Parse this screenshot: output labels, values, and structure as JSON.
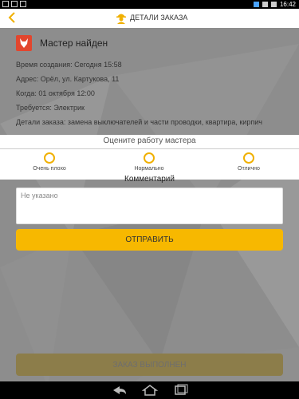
{
  "status_bar": {
    "time": "16:42"
  },
  "header": {
    "title": "ДЕТАЛИ ЗАКАЗА"
  },
  "order": {
    "status_title": "Мастер найден",
    "created": "Время создания: Сегодня 15:58",
    "address": "Адрес: Орёл, ул. Картукова, 11",
    "when": "Когда: 01 октября 12:00",
    "required": "Требуется: Электрик",
    "details": "Детали заказа: замена выключателей и части проводки, квартира, кирпич"
  },
  "rating": {
    "title": "Оцените работу мастера",
    "options": [
      {
        "label": "Очень плохо"
      },
      {
        "label": "Нормально"
      },
      {
        "label": "Отлично"
      }
    ]
  },
  "comment": {
    "title": "Комментарий",
    "placeholder": "Не указано"
  },
  "actions": {
    "send_label": "ОТПРАВИТЬ",
    "done_label": "ЗАКАЗ ВЫПОЛНЕН"
  },
  "colors": {
    "accent": "#f7b800",
    "master_badge": "#e2462e"
  }
}
